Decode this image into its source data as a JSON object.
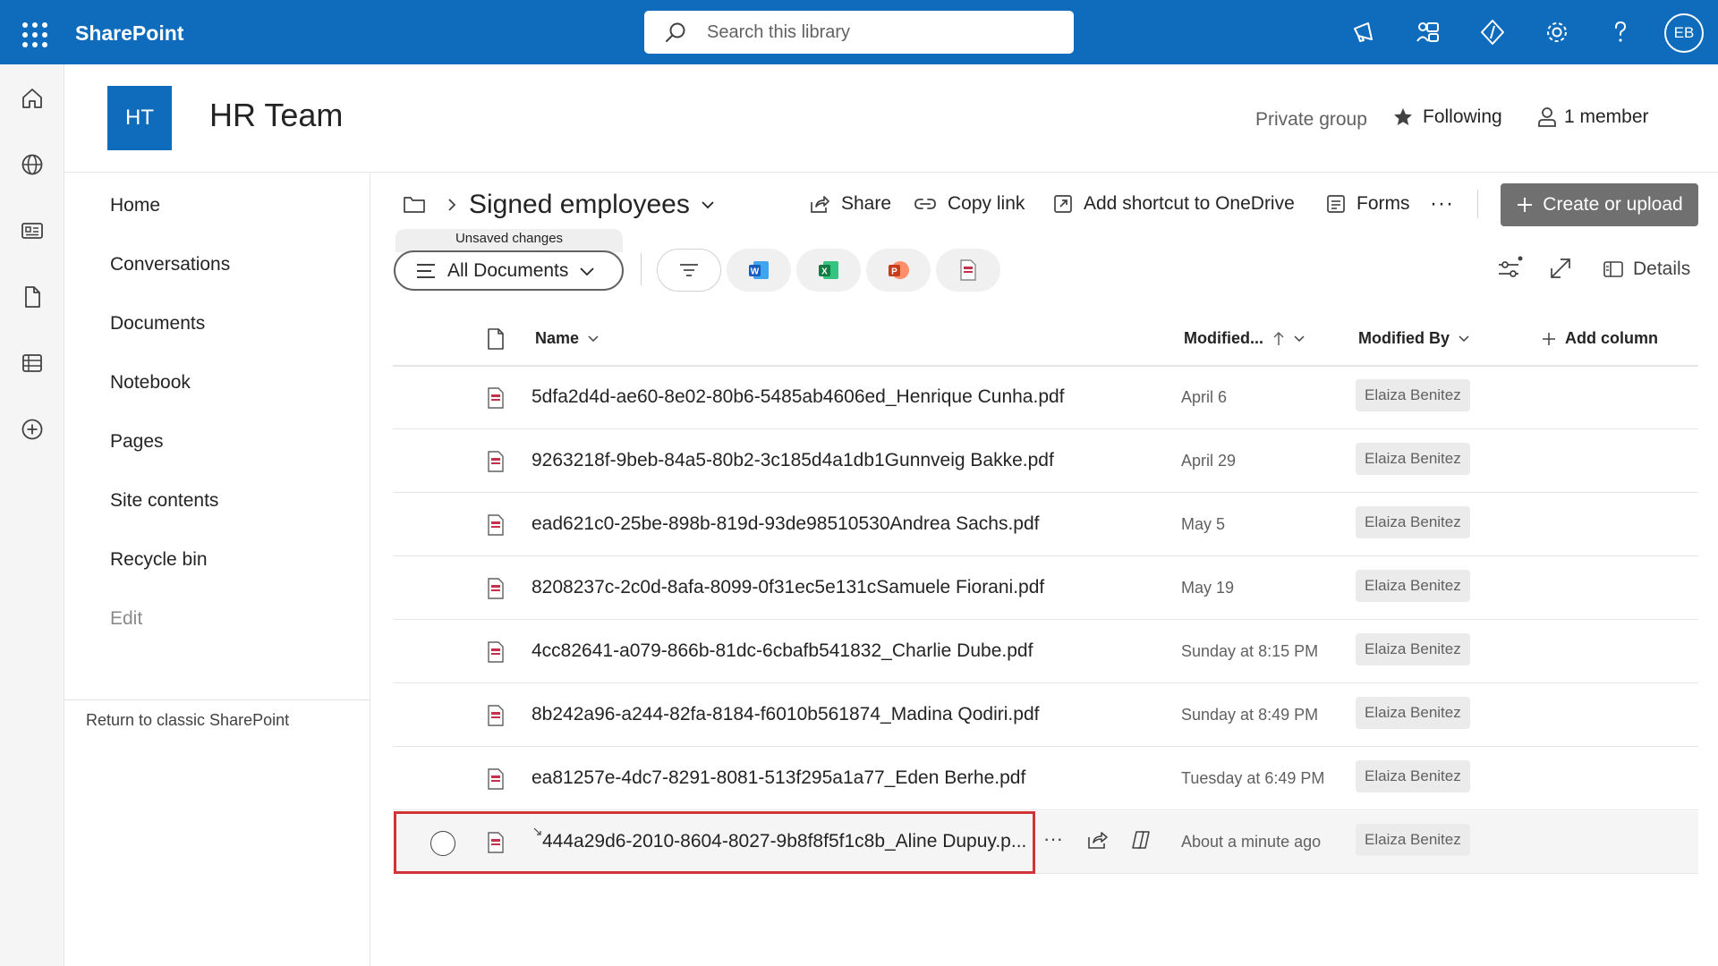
{
  "suite": {
    "brand": "SharePoint",
    "search_placeholder": "Search this library",
    "avatar_initials": "EB"
  },
  "site": {
    "logo": "HT",
    "title": "HR Team",
    "private_label": "Private group",
    "following_label": "Following",
    "members_label": "1 member"
  },
  "nav": {
    "items": [
      "Home",
      "Conversations",
      "Documents",
      "Notebook",
      "Pages",
      "Site contents",
      "Recycle bin"
    ],
    "edit": "Edit",
    "classic": "Return to classic SharePoint"
  },
  "library": {
    "title": "Signed employees",
    "commands": {
      "share": "Share",
      "copy_link": "Copy link",
      "shortcut": "Add shortcut to OneDrive",
      "forms": "Forms",
      "create": "Create or upload"
    },
    "view": {
      "unsaved": "Unsaved changes",
      "name": "All Documents"
    },
    "details": "Details",
    "columns": {
      "name": "Name",
      "modified": "Modified...",
      "modified_by": "Modified By",
      "add_column": "Add column"
    },
    "files": [
      {
        "name": "5dfa2d4d-ae60-8e02-80b6-5485ab4606ed_Henrique Cunha.pdf",
        "modified": "April 6",
        "by": "Elaiza Benitez"
      },
      {
        "name": "9263218f-9beb-84a5-80b2-3c185d4a1db1Gunnveig Bakke.pdf",
        "modified": "April 29",
        "by": "Elaiza Benitez"
      },
      {
        "name": "ead621c0-25be-898b-819d-93de98510530Andrea Sachs.pdf",
        "modified": "May 5",
        "by": "Elaiza Benitez"
      },
      {
        "name": "8208237c-2c0d-8afa-8099-0f31ec5e131cSamuele Fiorani.pdf",
        "modified": "May 19",
        "by": "Elaiza Benitez"
      },
      {
        "name": "4cc82641-a079-866b-81dc-6cbafb541832_Charlie Dube.pdf",
        "modified": "Sunday at 8:15 PM",
        "by": "Elaiza Benitez"
      },
      {
        "name": "8b242a96-a244-82fa-8184-f6010b561874_Madina Qodiri.pdf",
        "modified": "Sunday at 8:49 PM",
        "by": "Elaiza Benitez"
      },
      {
        "name": "ea81257e-4dc7-8291-8081-513f295a1a77_Eden Berhe.pdf",
        "modified": "Tuesday at 6:49 PM",
        "by": "Elaiza Benitez"
      },
      {
        "name": "444a29d6-2010-8604-8027-9b8f8f5f1c8b_Aline Dupuy.p...",
        "modified": "About a minute ago",
        "by": "Elaiza Benitez"
      }
    ]
  },
  "colors": {
    "suite_blue": "#0f6cbd",
    "highlight_red": "#d13438",
    "pdf_red": "#c4314b"
  },
  "icons": [
    "waffle-icon",
    "search-icon",
    "megaphone-icon",
    "share-icon",
    "dev-icon",
    "gear-icon",
    "help-icon",
    "home-icon",
    "globe-icon",
    "news-icon",
    "file-icon",
    "list-icon",
    "add-icon",
    "star-icon",
    "person-icon",
    "folder-icon",
    "pdf-icon",
    "word-icon",
    "excel-icon",
    "powerpoint-icon",
    "filter-icon"
  ]
}
